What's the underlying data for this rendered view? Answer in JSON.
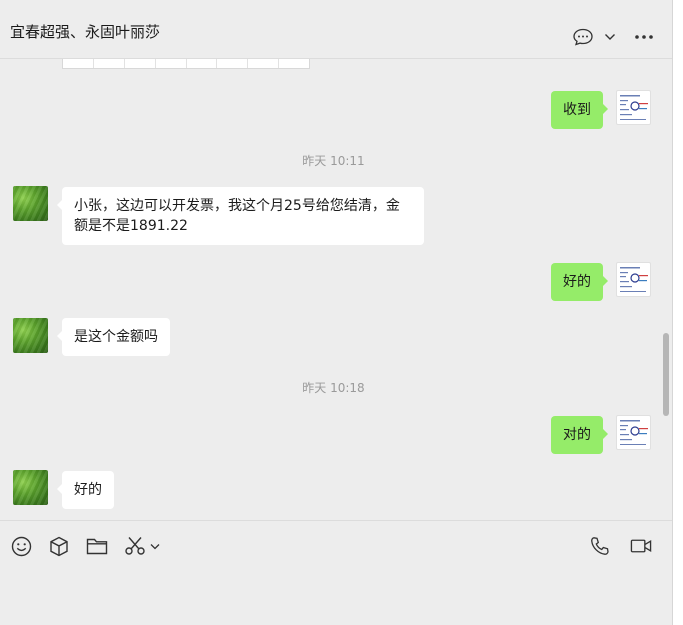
{
  "window": {
    "controls": {
      "pin_icon": "pin-icon",
      "minimize_icon": "minimize-icon",
      "maximize_icon": "maximize-icon",
      "close_icon": "close-icon"
    }
  },
  "header": {
    "title": "宜春超强、永固叶丽莎",
    "icons": [
      "chat-bubble-icon",
      "chevron-down-icon",
      "more-icon"
    ]
  },
  "messages": [
    {
      "type": "text",
      "side": "right",
      "text": "收到"
    },
    {
      "type": "time",
      "text": "昨天 10:11"
    },
    {
      "type": "text",
      "side": "left",
      "text": "小张，这边可以开发票，我这个月25号给您结清，金额是不是1891.22"
    },
    {
      "type": "text",
      "side": "right",
      "text": "好的"
    },
    {
      "type": "text",
      "side": "left",
      "text": "是这个金额吗"
    },
    {
      "type": "time",
      "text": "昨天 10:18"
    },
    {
      "type": "text",
      "side": "right",
      "text": "对的"
    },
    {
      "type": "text",
      "side": "left",
      "text": "好的"
    }
  ],
  "toolbar": {
    "left_icons": [
      "emoji-icon",
      "package-icon",
      "folder-icon",
      "scissors-icon",
      "chevron-down-icon"
    ],
    "right_icons": [
      "phone-icon",
      "video-call-icon"
    ]
  },
  "colors": {
    "background": "#ededed",
    "bubble_self": "#95ec69",
    "bubble_other": "#ffffff",
    "timestamp": "#9a9a9a"
  }
}
